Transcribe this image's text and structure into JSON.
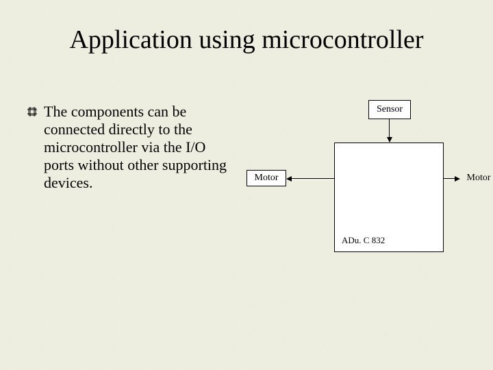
{
  "title": "Application using microcontroller",
  "bullet": {
    "text": "The components can be connected directly to the microcontroller via the I/O ports without other supporting devices."
  },
  "diagram": {
    "sensor": "Sensor",
    "motorLeft": "Motor",
    "motorRight": "Motor",
    "mcu": "ADu. C 832"
  }
}
